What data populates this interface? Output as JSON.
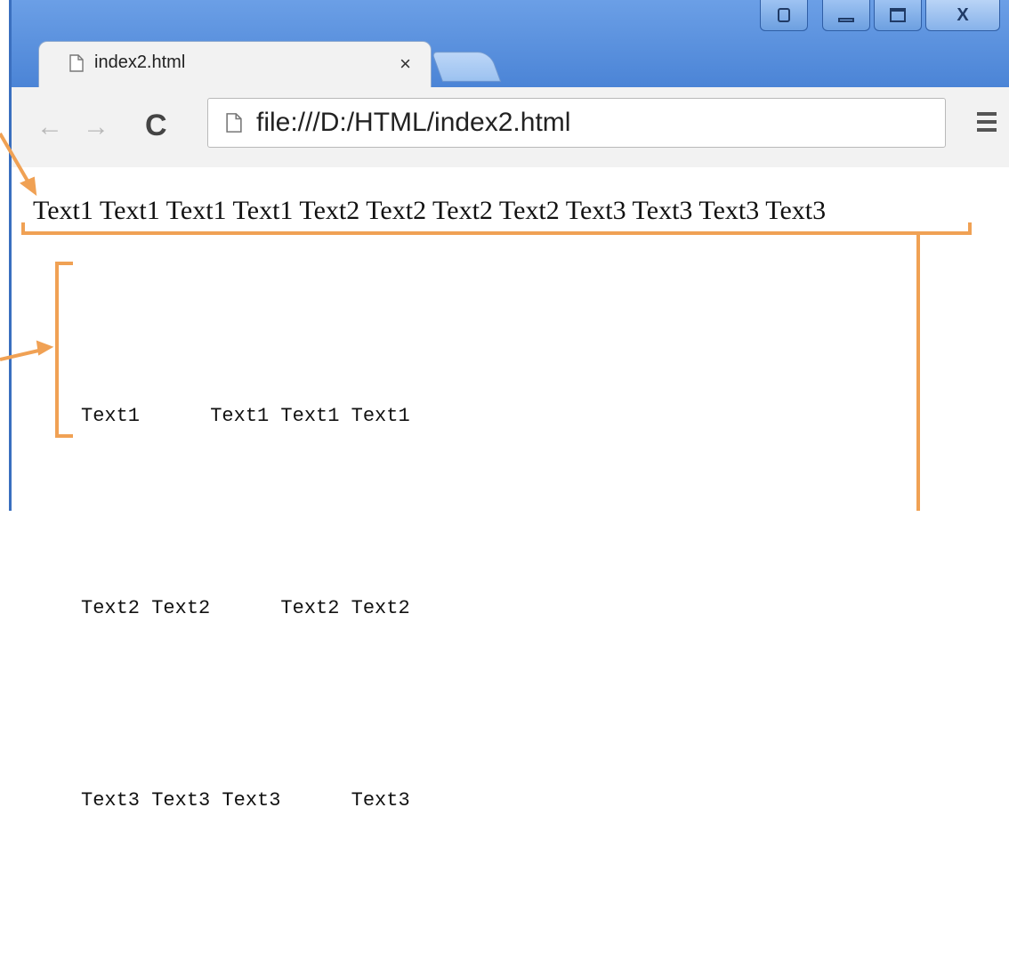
{
  "browser": {
    "tab_title": "index2.html",
    "tab_close": "×",
    "url": "file:///D:/HTML/index2.html",
    "nav": {
      "back": "←",
      "forward": "→",
      "reload": "C"
    },
    "icons": [
      "page-icon",
      "user-icon",
      "minimize-icon",
      "maximize-icon",
      "close-icon",
      "menu-icon"
    ]
  },
  "window_controls": {
    "close": "X"
  },
  "page": {
    "inline_text": "Text1 Text1 Text1 Text1 Text2 Text2 Text2 Text2 Text3 Text3 Text3 Text3",
    "pre_lines": [
      "Text1      Text1 Text1 Text1",
      "Text2 Text2      Text2 Text2",
      "Text3 Text3 Text3      Text3"
    ]
  },
  "colors": {
    "annotation": "#f0a154",
    "chrome_blue": "#4a86d6"
  }
}
